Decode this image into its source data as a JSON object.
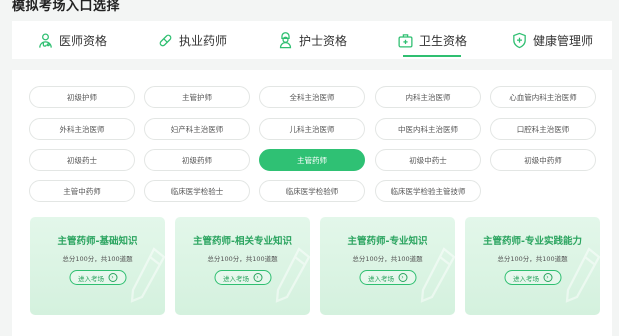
{
  "page": {
    "title": "模拟考场入口选择"
  },
  "tabs": [
    {
      "label": "医师资格",
      "icon": "doctor-icon",
      "active": false
    },
    {
      "label": "执业药师",
      "icon": "pill-icon",
      "active": false
    },
    {
      "label": "护士资格",
      "icon": "nurse-icon",
      "active": false
    },
    {
      "label": "卫生资格",
      "icon": "medical-kit-icon",
      "active": true
    },
    {
      "label": "健康管理师",
      "icon": "shield-plus-icon",
      "active": false
    }
  ],
  "chips": [
    [
      "初级护师",
      "主管护师",
      "全科主治医师",
      "内科主治医师",
      "心血管内科主治医师"
    ],
    [
      "外科主治医师",
      "妇产科主治医师",
      "儿科主治医师",
      "中医内科主治医师",
      "口腔科主治医师"
    ],
    [
      "初级药士",
      "初级药师",
      "主管药师",
      "初级中药士",
      "初级中药师"
    ],
    [
      "主管中药师",
      "临床医学检验士",
      "临床医学检验师",
      "临床医学检验主管技师"
    ]
  ],
  "selected_chip": "主管药师",
  "cards": [
    {
      "title": "主管药师-基础知识",
      "sub": "总分100分，共100道题",
      "button": "进入考场"
    },
    {
      "title": "主管药师-相关专业知识",
      "sub": "总分100分，共100道题",
      "button": "进入考场"
    },
    {
      "title": "主管药师-专业知识",
      "sub": "总分100分，共100道题",
      "button": "进入考场"
    },
    {
      "title": "主管药师-专业实践能力",
      "sub": "总分100分，共100道题",
      "button": "进入考场"
    }
  ],
  "colors": {
    "accent": "#2fc174",
    "card_bg": "#dff5e7",
    "card_title": "#2aa45f"
  }
}
